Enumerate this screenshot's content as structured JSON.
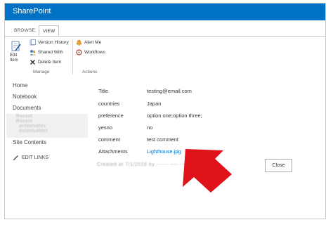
{
  "suite_bar": {
    "brand": "SharePoint"
  },
  "tabs": [
    "BROWSE",
    "VIEW"
  ],
  "ribbon": {
    "edit_item": {
      "label_line1": "Edit",
      "label_line2": "Item",
      "icon": "edit-item-icon"
    },
    "manage": {
      "items": [
        {
          "label": "Version History",
          "icon": "version-history-icon"
        },
        {
          "label": "Shared With",
          "icon": "shared-with-icon"
        },
        {
          "label": "Delete Item",
          "icon": "delete-icon"
        }
      ],
      "group_label": "Manage"
    },
    "actions": {
      "items": [
        {
          "label": "Alert Me",
          "icon": "alert-bell-icon"
        },
        {
          "label": "Workflows",
          "icon": "workflows-icon"
        }
      ],
      "group_label": "Actions"
    }
  },
  "left_nav": {
    "items": [
      "Home",
      "Notebook",
      "Documents"
    ],
    "blurred_lines": [
      "Recent",
      "Recent",
      "dsfdsfsdfds",
      "dsfdsfsdfdsf"
    ],
    "site_contents": "Site Contents",
    "edit_links": "EDIT LINKS"
  },
  "properties": [
    {
      "label": "Title",
      "value": "testing@email.com"
    },
    {
      "label": "countries",
      "value": "Japan"
    },
    {
      "label": "preference",
      "value": "option one;option three;"
    },
    {
      "label": "yesno",
      "value": "no"
    },
    {
      "label": "comment",
      "value": "test comment"
    },
    {
      "label": "Attachments",
      "value": "Lighthouse.jpg"
    }
  ],
  "blurred_footer": "Created at 7/1/2016 by ------ ---- ---- ----------",
  "close_button": "Close",
  "colors": {
    "suite_bar": "#0072c6",
    "link": "#0072c6",
    "arrow": "#e0121a"
  }
}
